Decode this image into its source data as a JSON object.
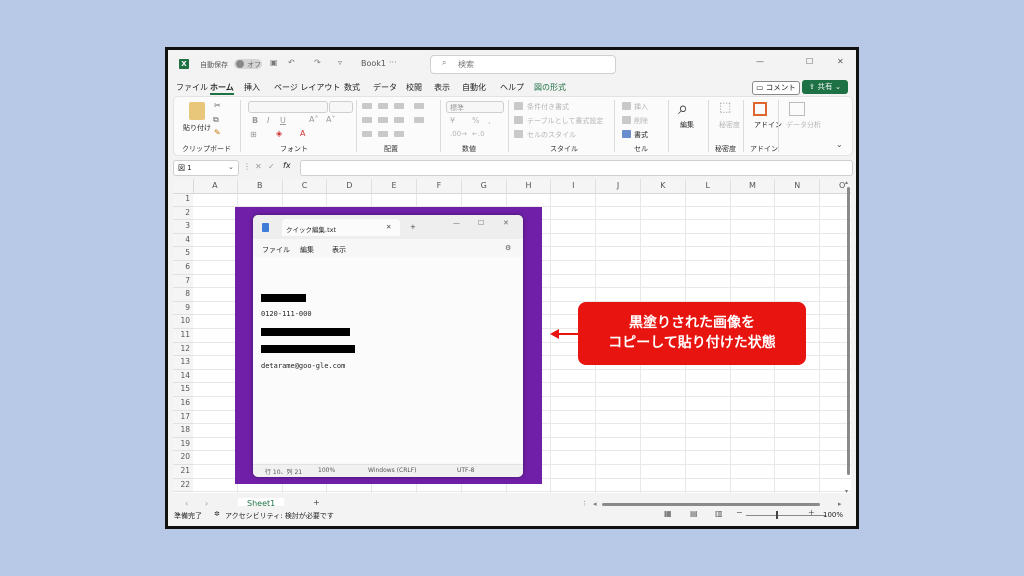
{
  "titlebar": {
    "autosave_label": "自動保存",
    "autosave_state": "オフ",
    "filename": "Book1",
    "filename_more": "···",
    "search_placeholder": "検索"
  },
  "menu": {
    "items": [
      "ファイル",
      "ホーム",
      "挿入",
      "ページ レイアウト",
      "数式",
      "データ",
      "校閲",
      "表示",
      "自動化",
      "ヘルプ",
      "図の形式"
    ],
    "active": "ホーム",
    "comment_label": "コメント",
    "share_label": "共有",
    "accent": "#1d7144"
  },
  "ribbon": {
    "paste_label": "貼り付け",
    "groups": [
      "クリップボード",
      "フォント",
      "配置",
      "数値",
      "スタイル",
      "セル",
      "秘密度",
      "アドイン"
    ],
    "number_format": "標準",
    "style_items": [
      "条件付き書式",
      "テーブルとして書式設定",
      "セルのスタイル"
    ],
    "cell_items": [
      "挿入",
      "削除",
      "書式"
    ],
    "edit_label": "編集",
    "sensitivity_label": "秘密度",
    "addin_label": "アドイン",
    "analyze_label": "データ分析"
  },
  "formula_bar": {
    "name_box": "図 1",
    "fx": "fx"
  },
  "grid": {
    "columns": [
      "A",
      "B",
      "C",
      "D",
      "E",
      "F",
      "G",
      "H",
      "I",
      "J",
      "K",
      "L",
      "M",
      "N",
      "O"
    ],
    "rows": [
      "1",
      "2",
      "3",
      "4",
      "5",
      "6",
      "7",
      "8",
      "9",
      "10",
      "11",
      "12",
      "13",
      "14",
      "15",
      "16",
      "17",
      "18",
      "19",
      "20",
      "21",
      "22"
    ]
  },
  "notepad": {
    "tab_title": "クイック編集.txt",
    "menu": [
      "ファイル",
      "編集",
      "表示"
    ],
    "lines": [
      "0120-111-000",
      "detarame@goo-gle.com"
    ],
    "status": [
      "行 10、列 21",
      "100%",
      "Windows (CRLF)",
      "UTF-8"
    ],
    "border_color": "#6f1fa8"
  },
  "sheets": {
    "tabs": [
      "Sheet1"
    ],
    "add_label": "+"
  },
  "statusbar": {
    "ready": "準備完了",
    "accessibility": "アクセシビリティ: 検討が必要です",
    "zoom": "100%"
  },
  "callout": {
    "line1": "黒塗りされた画像を",
    "line2": "コピーして貼り付けた状態",
    "color": "#e8140f"
  }
}
